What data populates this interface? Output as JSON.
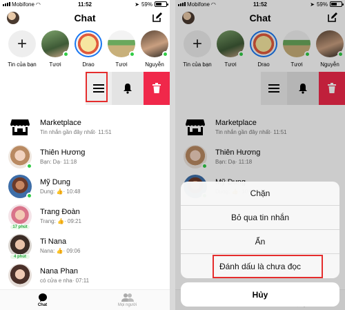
{
  "status": {
    "carrier": "Mobifone",
    "time": "11:52",
    "battery": "59%",
    "battery_level": 0.59
  },
  "header": {
    "title": "Chat"
  },
  "stories": [
    {
      "label": "Tin của bạn"
    },
    {
      "label": "Tươi"
    },
    {
      "label": "Drao"
    },
    {
      "label": "Tươi"
    },
    {
      "label": "Nguyễn"
    }
  ],
  "conversations": [
    {
      "name": "Marketplace",
      "preview": "Tin nhắn gần đây nhất· 11:51"
    },
    {
      "name": "Thiên Hương",
      "preview": "Bạn: Dạ· 11:18"
    },
    {
      "name": "Mỹ Dung",
      "preview": "Dung: 👍· 10:48"
    },
    {
      "name": "Trang Đoàn",
      "preview": "Trang: 👍· 09:21",
      "badge": "17 phút"
    },
    {
      "name": "Ti Nana",
      "preview": "Nana: 👍· 09:06",
      "badge": "4 phút"
    },
    {
      "name": "Nana Phan",
      "preview": "có cửa e nha· 07:11"
    }
  ],
  "tabs": {
    "chat": "Chat",
    "people": "Mọi người"
  },
  "action_sheet": {
    "options": [
      "Chặn",
      "Bỏ qua tin nhắn",
      "Ẩn",
      "Đánh dấu là chưa đọc"
    ],
    "cancel": "Hủy"
  },
  "colors": {
    "accent": "#1877f2",
    "delete": "#f0284a",
    "online": "#31cc46",
    "highlight": "#e52c2c"
  }
}
